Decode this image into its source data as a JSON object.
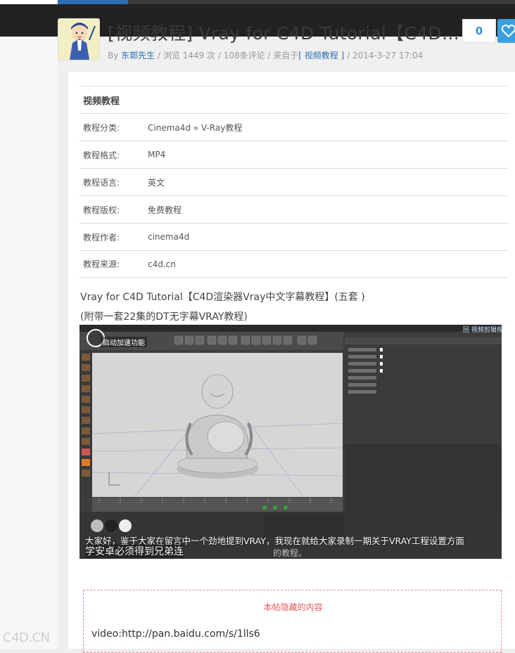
{
  "post": {
    "title": "[视频教程] Vray for C4D Tutorial【C4D…",
    "meta_by": "By ",
    "author": "东郭先生",
    "meta_views": " / 浏览 1449 次 / 108条评论 / 来自于",
    "category": "[ 视频教程 ]",
    "meta_date": " / 2014-3-27 17:04",
    "like_count": "0"
  },
  "info": {
    "heading": "视频教程",
    "rows": [
      {
        "key": "教程分类:",
        "value": "Cinema4d » V-Ray教程"
      },
      {
        "key": "教程格式:",
        "value": "MP4"
      },
      {
        "key": "教程语言:",
        "value": "英文"
      },
      {
        "key": "教程版权:",
        "value": "免费教程"
      },
      {
        "key": "教程作者:",
        "value": "cinema4d"
      },
      {
        "key": "教程来源:",
        "value": "c4d.cn"
      }
    ]
  },
  "description": {
    "line1": "Vray for C4D Tutorial【C4D渲染器Vray中文字幕教程】(五套 )",
    "line2": "(附带一套22集的DT无字幕VRAY教程)"
  },
  "video": {
    "accelerate_label": "启动加速功能",
    "channel_label": "回 视频剪辑视频",
    "subtitle_line1": "大家好，鉴于大家在留言中一个劲地提到VRAY，我现在就给大家录制一期关于VRAY工程设置方面",
    "subtitle_line2": "学安卓必须得到兄弟连",
    "subtitle_line3": "的教程。"
  },
  "hidden": {
    "title": "本帖隐藏的内容",
    "link": "video:http://pan.baidu.com/s/1lls6"
  },
  "watermark": "C4D.CN",
  "colors": {
    "accent": "#2a6fb5",
    "like_button": "#3aa0e0",
    "hidden_border": "#e88a8a"
  }
}
